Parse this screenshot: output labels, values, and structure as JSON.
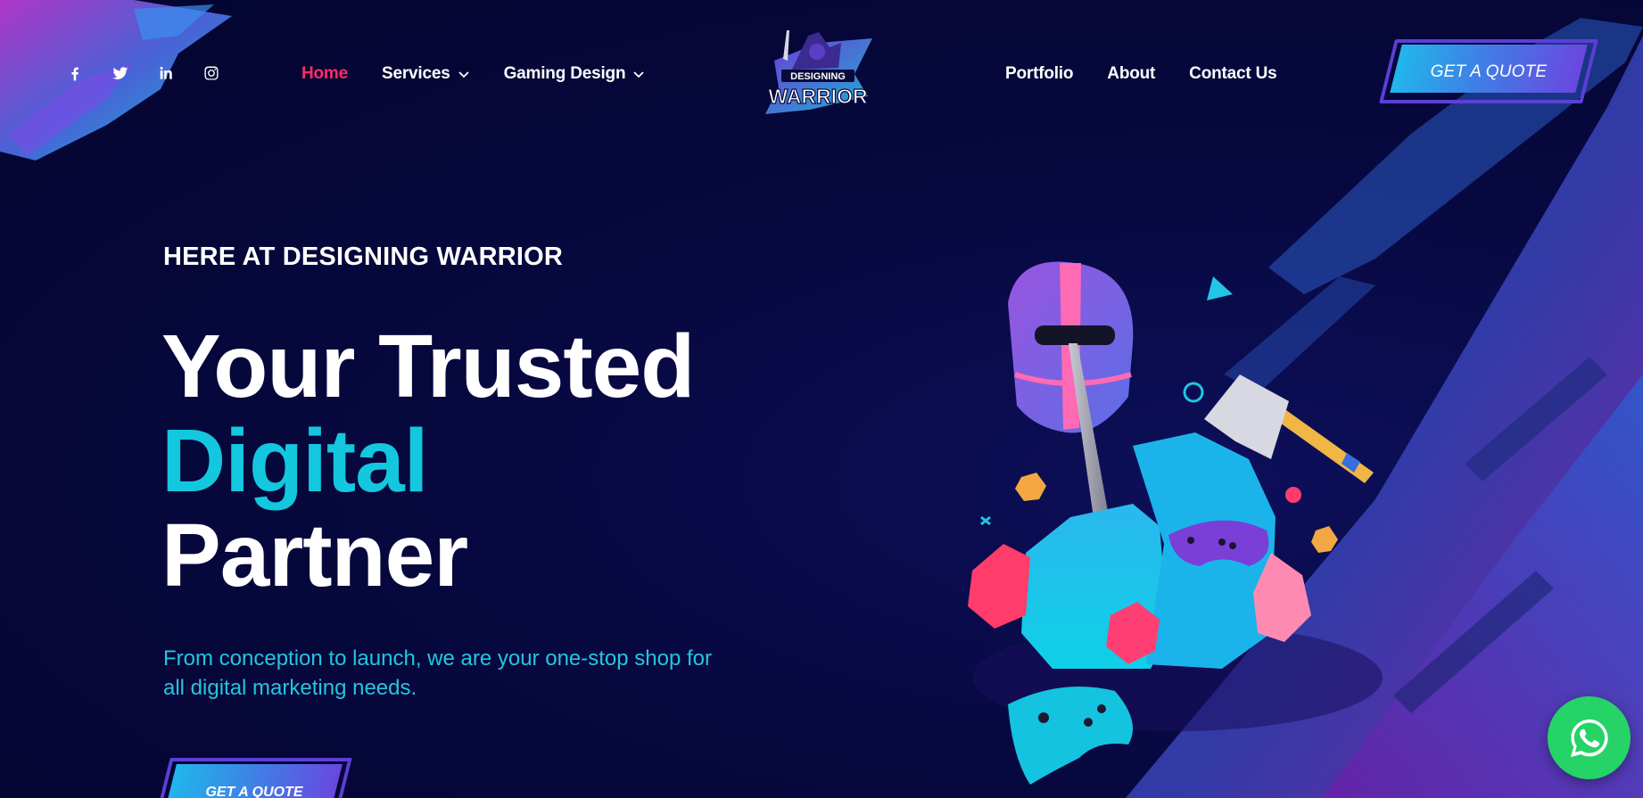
{
  "header": {
    "social": [
      "facebook-icon",
      "twitter-icon",
      "linkedin-icon",
      "instagram-icon"
    ],
    "nav_left": [
      {
        "label": "Home",
        "active": true
      },
      {
        "label": "Services",
        "dropdown": true
      },
      {
        "label": "Gaming Design",
        "dropdown": true
      }
    ],
    "nav_right": [
      {
        "label": "Portfolio"
      },
      {
        "label": "About"
      },
      {
        "label": "Contact Us"
      }
    ],
    "logo": {
      "line1": "DESIGNING",
      "line2": "WARRIOR"
    },
    "quote_button": "GET A QUOTE"
  },
  "hero": {
    "eyebrow": "HERE AT DESIGNING WARRIOR",
    "title_line1": "Your Trusted",
    "title_line2": "Digital",
    "title_line3": "Partner",
    "subtext": "From conception to launch, we are your one-stop shop for all digital marketing needs.",
    "cta": "GET A QUOTE"
  },
  "colors": {
    "background": "#05063a",
    "accent_cyan": "#13c7de",
    "active_pink": "#ff2d6b",
    "whatsapp_green": "#25d366"
  }
}
